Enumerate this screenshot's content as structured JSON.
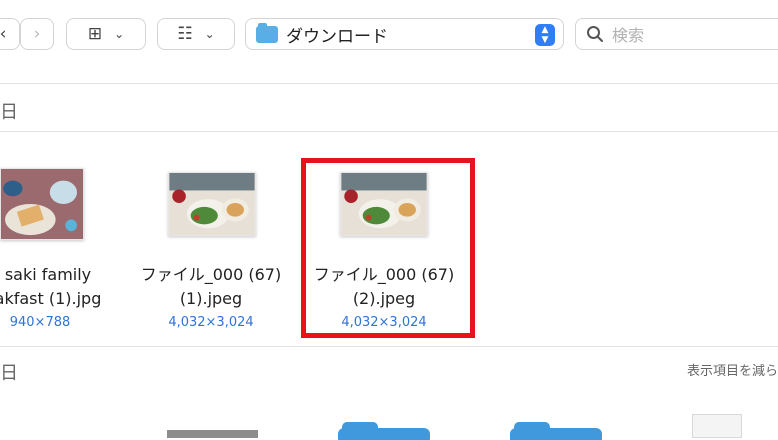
{
  "toolbar": {
    "back_icon": "chevron-left-icon",
    "forward_icon": "chevron-right-icon",
    "view_icon": "grid-view-icon",
    "group_icon": "group-by-icon",
    "path_label": "ダウンロード",
    "search_placeholder": "検索"
  },
  "sections": [
    {
      "title": "日",
      "items": [
        {
          "name_line1": "saki family",
          "name_line2": "akfast (1).jpg",
          "dims": "940×788"
        },
        {
          "name_line1": "ファイル_000 (67)",
          "name_line2": "(1).jpeg",
          "dims": "4,032×3,024"
        },
        {
          "name_line1": "ファイル_000 (67)",
          "name_line2": "(2).jpeg",
          "dims": "4,032×3,024"
        }
      ]
    },
    {
      "title": "日",
      "action": "表示項目を減ら"
    }
  ],
  "colors": {
    "accent": "#2f7ef6",
    "folder": "#5aaee6",
    "highlight": "#e8141b",
    "dims_text": "#2f74d6"
  }
}
